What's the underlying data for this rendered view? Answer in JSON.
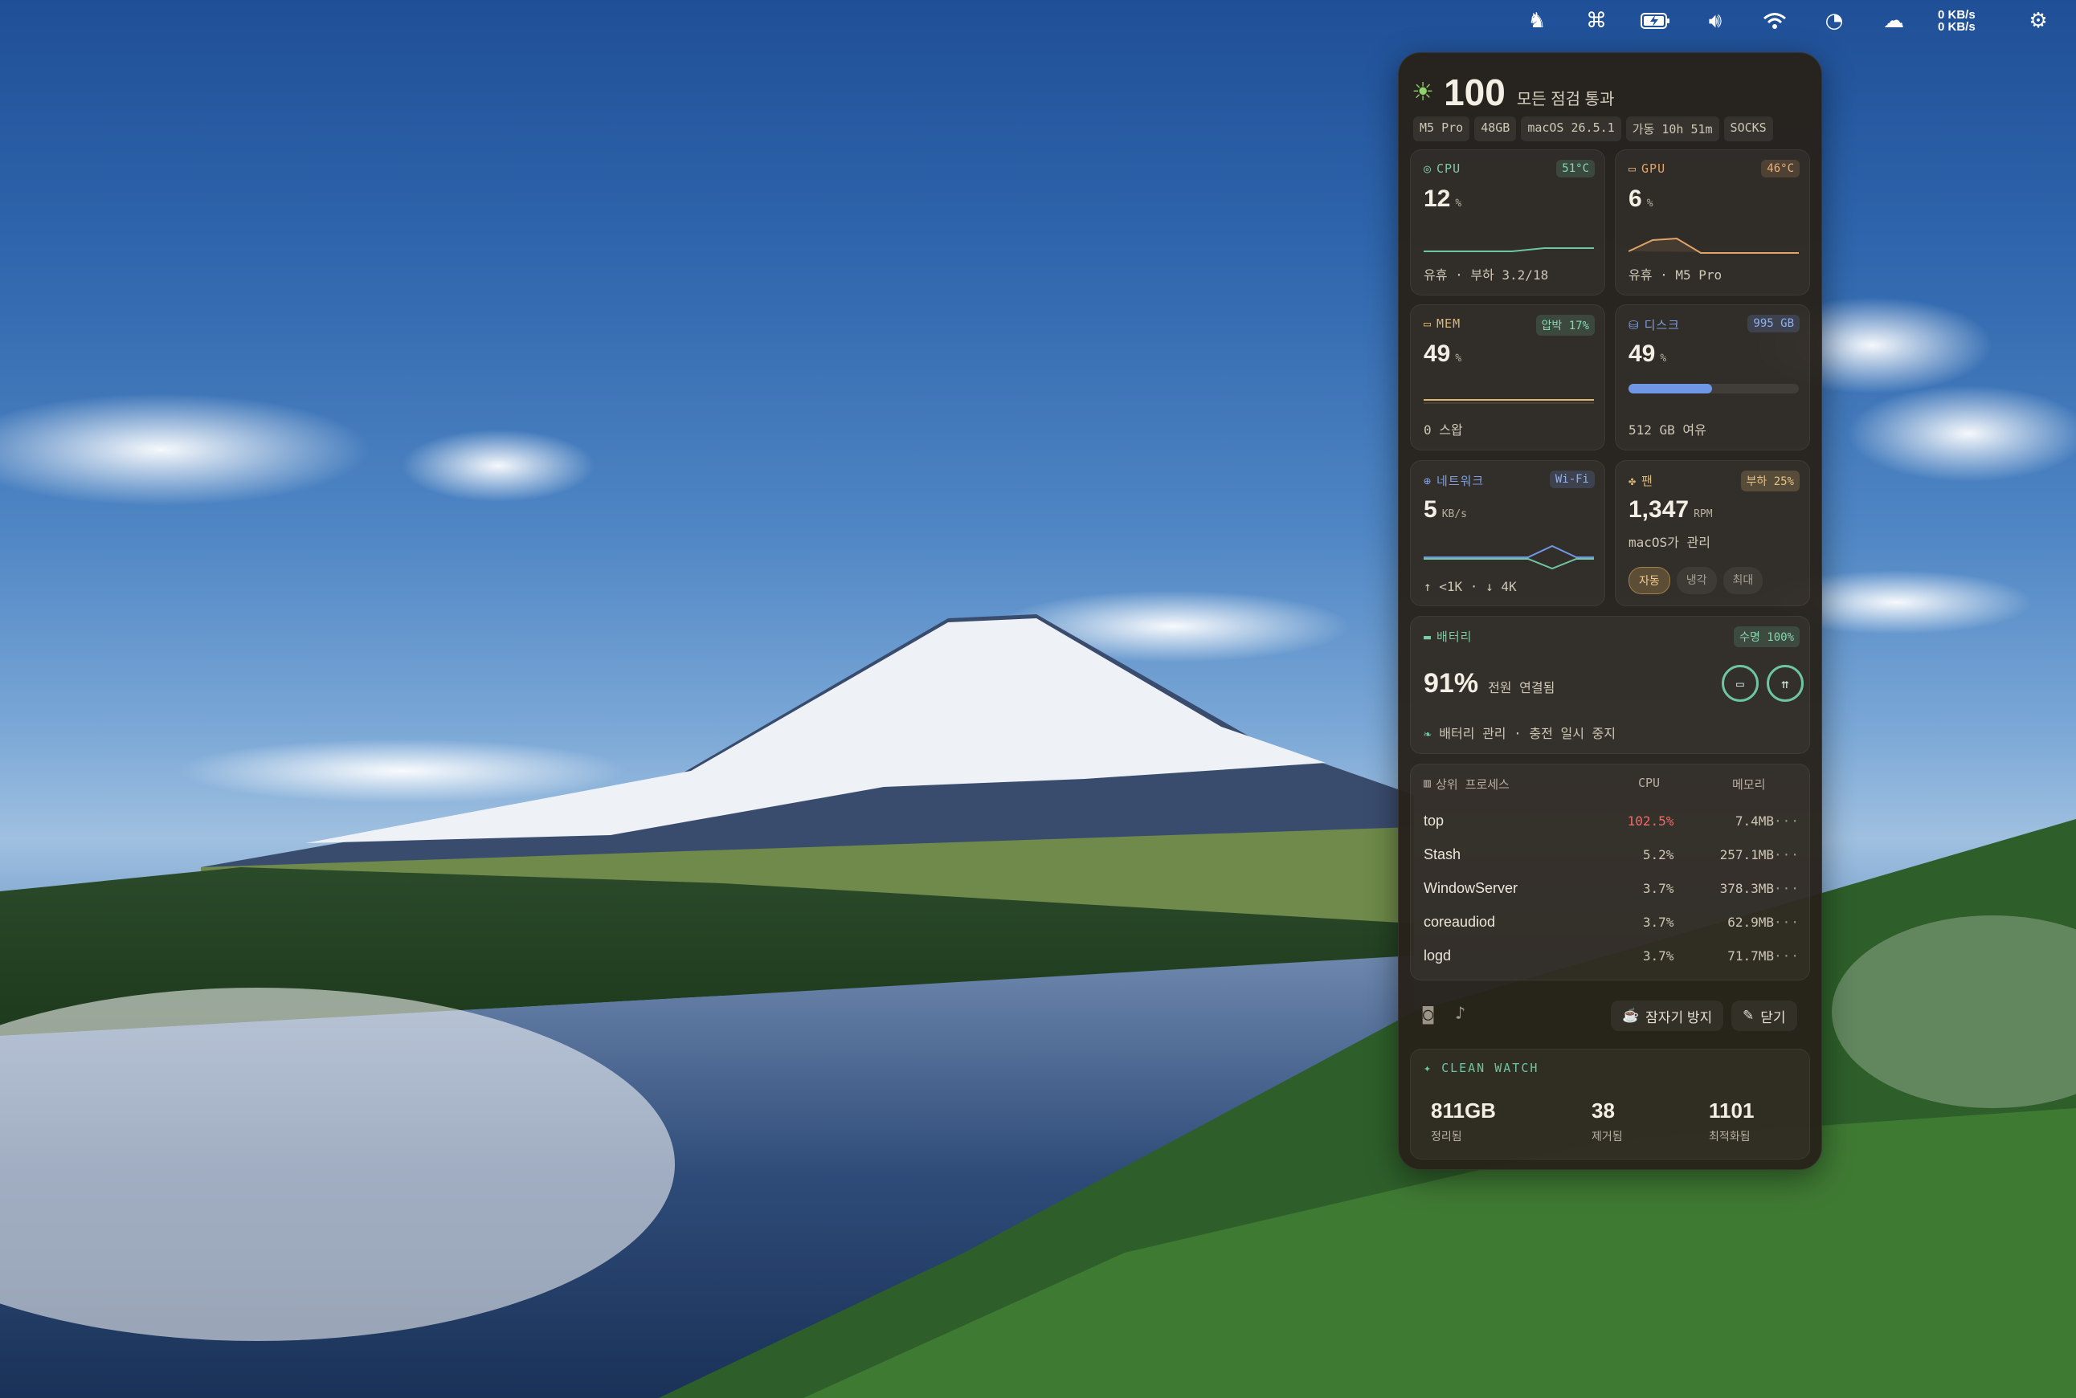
{
  "menubar": {
    "icons": [
      "horse-icon",
      "command-icon",
      "battery-charging-icon",
      "volume-icon",
      "wifi-icon",
      "sync-icon",
      "cloud-upload-icon",
      "control-center-icon"
    ],
    "net_up": "0 KB/s",
    "net_down": "0 KB/s"
  },
  "panel": {
    "score": "100",
    "score_text": "모든 점검 통과",
    "chips": [
      "M5 Pro",
      "48GB",
      "macOS 26.5.1",
      "가동 10h 51m",
      "SOCKS"
    ],
    "cpu": {
      "title": "CPU",
      "badge": "51°C",
      "value": "12",
      "unit": "%",
      "foot": "유휴 · 부하 3.2/18"
    },
    "gpu": {
      "title": "GPU",
      "badge": "46°C",
      "value": "6",
      "unit": "%",
      "foot": "유휴 · M5 Pro"
    },
    "mem": {
      "title": "MEM",
      "badge": "압박 17%",
      "value": "49",
      "unit": "%",
      "foot": "0 스왑"
    },
    "disk": {
      "title": "디스크",
      "badge": "995 GB",
      "value": "49",
      "unit": "%",
      "foot": "512 GB 여유",
      "fill": 0.49
    },
    "network": {
      "title": "네트워크",
      "badge": "Wi-Fi",
      "value": "5",
      "unit": "KB/s",
      "foot": "↑ <1K · ↓ 4K"
    },
    "fan": {
      "title": "팬",
      "badge": "부하 25%",
      "value": "1,347",
      "unit": "RPM",
      "sub": "macOS가 관리",
      "modes": [
        "자동",
        "냉각",
        "최대"
      ],
      "active_mode": "자동"
    },
    "battery": {
      "title": "배터리",
      "badge": "수명 100%",
      "value": "91%",
      "status": "전원 연결됨",
      "foot": "배터리 관리 · 충전 일시 중지"
    },
    "processes": {
      "title": "상위 프로세스",
      "col_cpu": "CPU",
      "col_mem": "메모리",
      "rows": [
        {
          "name": "top",
          "cpu": "102.5%",
          "mem": "7.4MB",
          "hot": true
        },
        {
          "name": "Stash",
          "cpu": "5.2%",
          "mem": "257.1MB"
        },
        {
          "name": "WindowServer",
          "cpu": "3.7%",
          "mem": "378.3MB"
        },
        {
          "name": "coreaudiod",
          "cpu": "3.7%",
          "mem": "62.9MB"
        },
        {
          "name": "logd",
          "cpu": "3.7%",
          "mem": "71.7MB"
        }
      ]
    },
    "actions": {
      "keepawake": "잠자기 방지",
      "close": "닫기"
    },
    "cleanwatch": {
      "title": "CLEAN WATCH",
      "stats": [
        {
          "value": "811GB",
          "label": "정리됨"
        },
        {
          "value": "38",
          "label": "제거됨"
        },
        {
          "value": "1101",
          "label": "최적화됨"
        }
      ]
    }
  },
  "colors": {
    "green": "#6ec5a2",
    "orange": "#e0a468",
    "blue": "#6f97e6",
    "red": "#f06b6b",
    "gold": "#d9b778"
  }
}
